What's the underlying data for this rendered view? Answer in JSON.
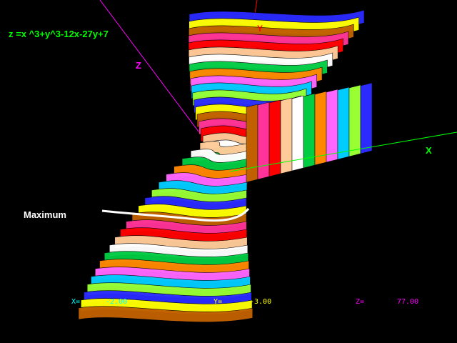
{
  "equation": "z =x ^3+y^3-12x-27y+7",
  "annotation": "Maximum",
  "axes": {
    "x": "X",
    "y": "Y",
    "z": "Z"
  },
  "readout": {
    "x_label": "X=",
    "x_value": "-2.00",
    "y_label": "Y=",
    "y_value": "-3.00",
    "z_label": "Z=",
    "z_value": "77.00"
  },
  "colors": {
    "background": "#000000",
    "equation_text": "#00ff00",
    "annotation_text": "#ffffff",
    "axis_x": "#00ff00",
    "axis_y": "#ff0000",
    "axis_z": "#ff00ff",
    "readout_x": "#00ffff",
    "readout_y": "#ffff00",
    "readout_z": "#ff00ff",
    "highlight_curve": "#ffffff",
    "bands": [
      "#2b2bff",
      "#ffff00",
      "#c06000",
      "#ff3399",
      "#ff0000",
      "#ffcc99",
      "#ffffff",
      "#00cc44",
      "#ff8800",
      "#ff66ff",
      "#00ccff",
      "#99ff33"
    ]
  }
}
